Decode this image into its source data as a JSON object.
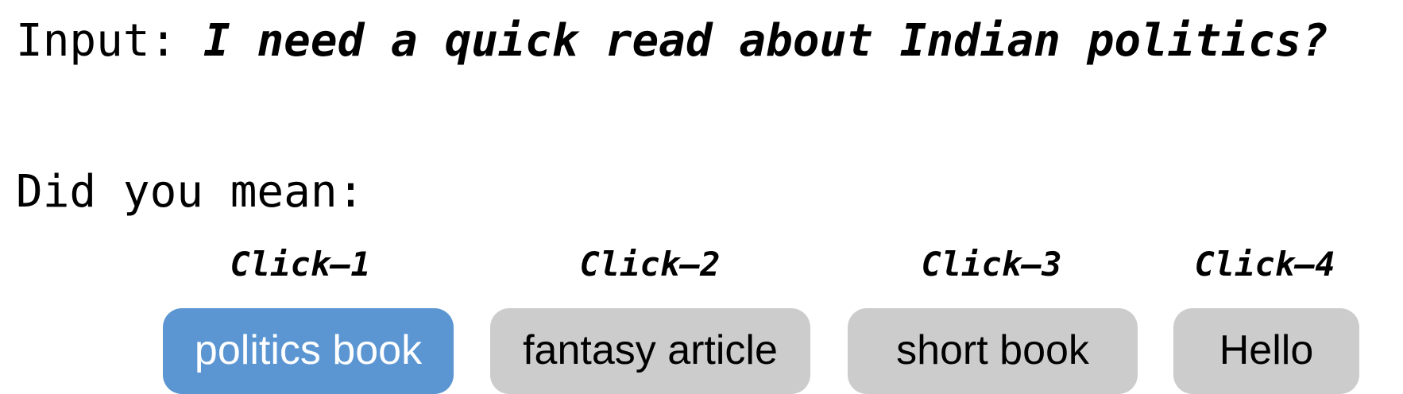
{
  "input": {
    "label": "Input:",
    "query": "I need a quick read about Indian politics?"
  },
  "prompt": "Did you mean:",
  "colors": {
    "selected": "#5b96d3",
    "unselected": "#cccccc",
    "selected_text": "#ffffff",
    "unselected_text": "#000000"
  },
  "options": [
    {
      "click_label": "Click–1",
      "label": "politics book",
      "selected": true
    },
    {
      "click_label": "Click–2",
      "label": "fantasy article",
      "selected": false
    },
    {
      "click_label": "Click–3",
      "label": "short book",
      "selected": false
    },
    {
      "click_label": "Click–4",
      "label": "Hello",
      "selected": false
    }
  ]
}
